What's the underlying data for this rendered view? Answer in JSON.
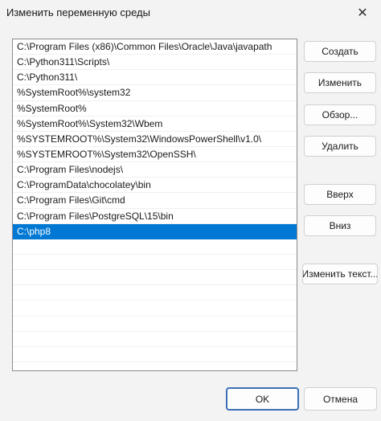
{
  "window": {
    "title": "Изменить переменную среды",
    "close_glyph": "✕"
  },
  "paths": [
    "C:\\Program Files (x86)\\Common Files\\Oracle\\Java\\javapath",
    "C:\\Python311\\Scripts\\",
    "C:\\Python311\\",
    "%SystemRoot%\\system32",
    "%SystemRoot%",
    "%SystemRoot%\\System32\\Wbem",
    "%SYSTEMROOT%\\System32\\WindowsPowerShell\\v1.0\\",
    "%SYSTEMROOT%\\System32\\OpenSSH\\",
    "C:\\Program Files\\nodejs\\",
    "C:\\ProgramData\\chocolatey\\bin",
    "C:\\Program Files\\Git\\cmd",
    "C:\\Program Files\\PostgreSQL\\15\\bin",
    "C:\\php8"
  ],
  "selected_index": 12,
  "buttons": {
    "create": "Создать",
    "edit": "Изменить",
    "browse": "Обзор...",
    "delete": "Удалить",
    "up": "Вверх",
    "down": "Вниз",
    "edit_text": "Изменить текст..."
  },
  "footer": {
    "ok": "OK",
    "cancel": "Отмена"
  },
  "colors": {
    "selection": "#0078d4",
    "ok_border": "#3b6fb6"
  }
}
